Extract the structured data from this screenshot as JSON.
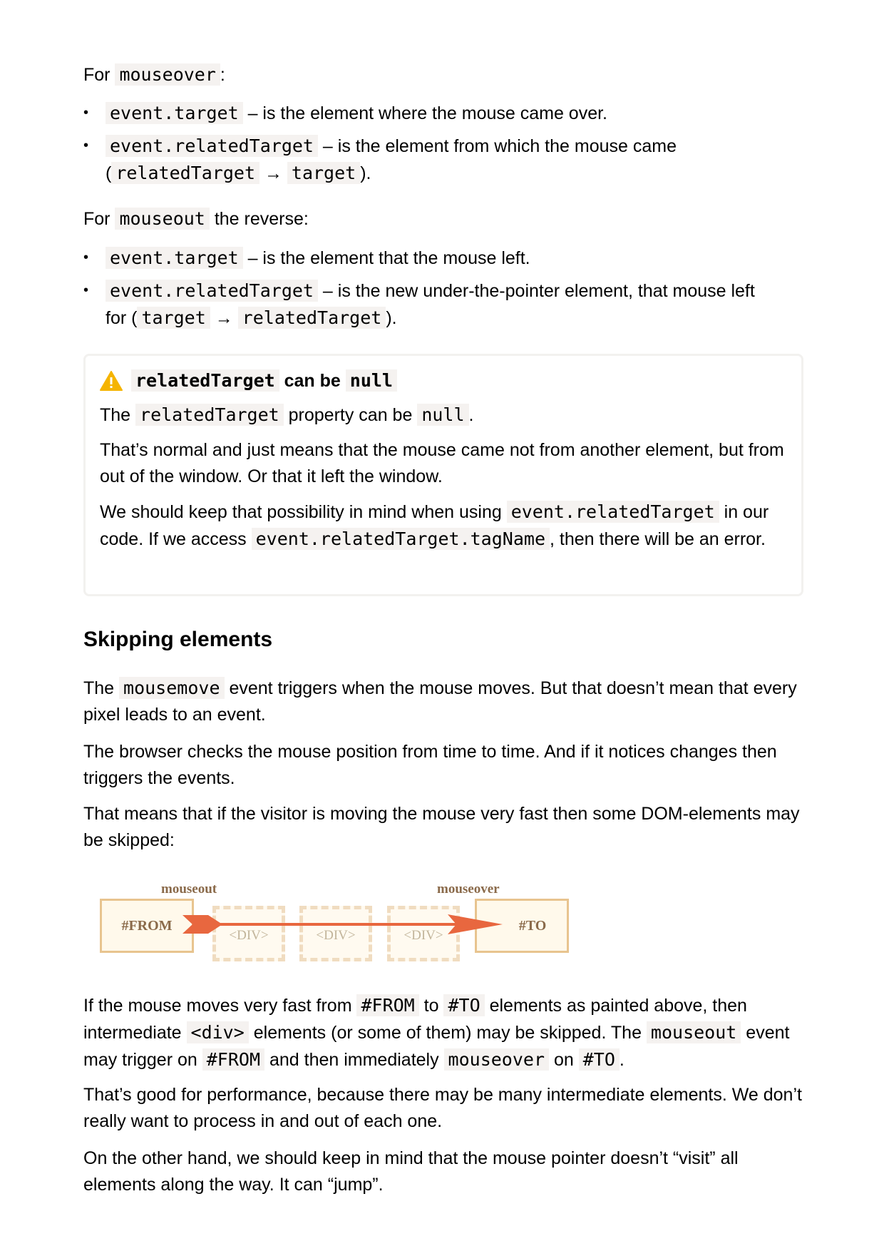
{
  "mouseover_section": {
    "intro_for": "For",
    "intro_code": "mouseover",
    "intro_colon": ":",
    "items": [
      {
        "code": "event.target",
        "text": " – is the element where the mouse came over."
      },
      {
        "code": "event.relatedTarget",
        "text": " – is the element from which the mouse came",
        "line2_open": "(",
        "code2": "relatedTarget",
        "arrow": " → ",
        "code3": "target",
        "line2_close": ")."
      }
    ]
  },
  "mouseout_section": {
    "intro_for": "For",
    "intro_code": "mouseout",
    "intro_rest": " the reverse:",
    "items": [
      {
        "code": "event.target",
        "text": " – is the element that the mouse left."
      },
      {
        "code": "event.relatedTarget",
        "text": " – is the new under-the-pointer element, that mouse left",
        "line2_open": "for (",
        "code2": "target",
        "arrow": " → ",
        "code3": "relatedTarget",
        "line2_close": ")."
      }
    ]
  },
  "warning": {
    "icon": "warning-icon",
    "title_code1": "relatedTarget",
    "title_mid": " can be ",
    "title_code2": "null",
    "p1_a": "The ",
    "p1_code": "relatedTarget",
    "p1_b": " property can be ",
    "p1_code2": "null",
    "p1_c": ".",
    "p2": "That’s normal and just means that the mouse came not from another element, but from out of the window. Or that it left the window.",
    "p3_a": "We should keep that possibility in mind when using ",
    "p3_code": "event.relatedTarget",
    "p3_b": " in our code. If we access ",
    "p3_code2": "event.relatedTarget.tagName",
    "p3_c": ", then there will be an error."
  },
  "skipping": {
    "heading": "Skipping elements",
    "p1_a": "The ",
    "p1_code": "mousemove",
    "p1_b": " event triggers when the mouse moves. But that doesn’t mean that every pixel leads to an event.",
    "p2": "The browser checks the mouse position from time to time. And if it notices changes then triggers the events.",
    "p3": "That means that if the visitor is moving the mouse very fast then some DOM-elements may be skipped:",
    "diagram": {
      "label_left": "mouseout",
      "label_right": "mouseover",
      "from": "#FROM",
      "to": "#TO",
      "divs": [
        "<DIV>",
        "<DIV>",
        "<DIV>"
      ]
    },
    "p4_a": "If the mouse moves very fast from ",
    "p4_code1": "#FROM",
    "p4_b": " to ",
    "p4_code2": "#TO",
    "p4_c": " elements as painted above, then intermediate ",
    "p4_code3": "<div>",
    "p4_d": " elements (or some of them) may be skipped. The ",
    "p4_code4": "mouseout",
    "p4_e": " event may trigger on ",
    "p4_code5": "#FROM",
    "p4_f": " and then immediately ",
    "p4_code6": "mouseover",
    "p4_g": " on ",
    "p4_code7": "#TO",
    "p4_h": ".",
    "p5": "That’s good for performance, because there may be many intermediate elements. We don’t really want to process in and out of each one.",
    "p6": "On the other hand, we should keep in mind that the mouse pointer doesn’t “visit” all elements along the way. It can “jump”."
  },
  "colors": {
    "code_bg": "#f5f2f0",
    "arrow": "#e8673f",
    "warning_icon": "#f5b400"
  }
}
